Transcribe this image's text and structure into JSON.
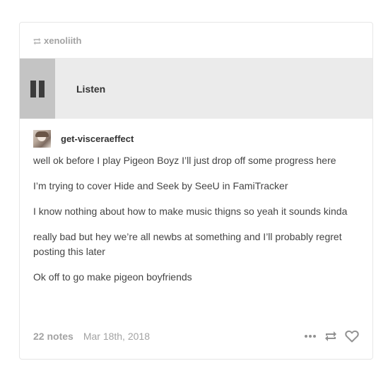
{
  "reblog": {
    "username": "xenoliith",
    "icon": "reblog-icon"
  },
  "audio": {
    "label": "Listen",
    "progress": 0.1,
    "state": "playing"
  },
  "author": {
    "name": "get-visceraeffect",
    "avatar": "avatar"
  },
  "body": {
    "paragraphs": [
      "well ok before I play Pigeon Boyz I’ll just drop off some progress here",
      "I’m trying to cover Hide and Seek by SeeU in FamiTracker",
      "I know nothing about how to make music thigns so yeah it sounds kinda",
      "really bad but hey we’re all newbs at something and I’ll probably regret posting this later",
      "Ok off to go make pigeon boyfriends"
    ]
  },
  "footer": {
    "notes": "22 notes",
    "date": "Mar 18th, 2018",
    "actions": [
      "more-icon",
      "reblog-icon",
      "heart-icon"
    ]
  },
  "colors": {
    "muted": "#a3a3a3",
    "text": "#444444",
    "player_bg": "#ebebeb",
    "player_progress": "#c4c4c4"
  }
}
